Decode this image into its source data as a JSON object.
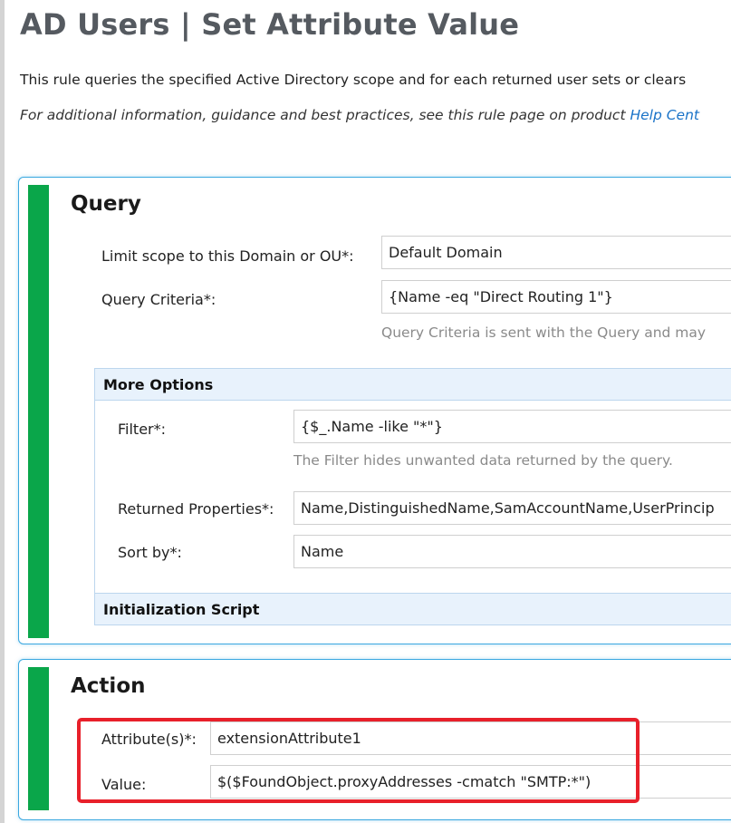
{
  "page": {
    "title": "AD Users | Set Attribute Value",
    "description": "This rule queries the specified Active Directory scope and for each returned user sets or clears",
    "help_prefix": "For additional information, guidance and best practices, see this rule page on product ",
    "help_link": "Help Cent"
  },
  "query": {
    "title": "Query",
    "scope_label": "Limit scope to this Domain or OU*:",
    "scope_value": "Default Domain",
    "criteria_label": "Query Criteria*:",
    "criteria_value": "{Name -eq \"Direct Routing 1\"}",
    "criteria_hint": "Query Criteria is sent with the Query and may",
    "more_options": {
      "title": "More Options",
      "filter_label": "Filter*:",
      "filter_value": "{$_.Name -like \"*\"}",
      "filter_hint": "The Filter hides unwanted data returned by the query.",
      "props_label": "Returned Properties*:",
      "props_value": "Name,DistinguishedName,SamAccountName,UserPrincip",
      "sort_label": "Sort by*:",
      "sort_value": "Name"
    },
    "init_script_title": "Initialization Script"
  },
  "action": {
    "title": "Action",
    "attribute_label": "Attribute(s)*:",
    "attribute_value": "extensionAttribute1",
    "value_label": "Value:",
    "value_value": "$($FoundObject.proxyAddresses -cmatch \"SMTP:*\")"
  },
  "colors": {
    "accent_green": "#0aa64a",
    "panel_border": "#3aa8e0",
    "highlight_red": "#e8202a",
    "link": "#1a73c8"
  }
}
